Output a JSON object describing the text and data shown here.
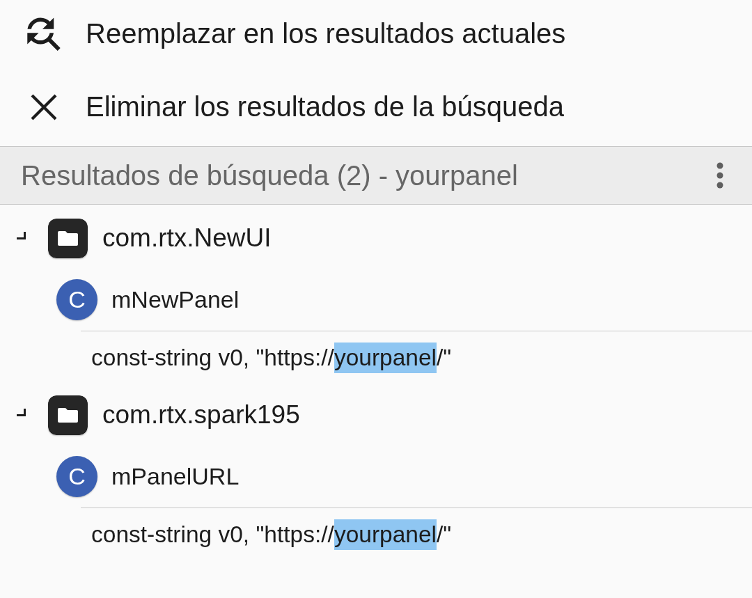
{
  "menu": [
    {
      "kind": "find_replace",
      "label": "Reemplazar en los resultados actuales"
    },
    {
      "kind": "close",
      "label": "Eliminar los resultados de la búsqueda"
    }
  ],
  "results_header": {
    "title": "Resultados de búsqueda (2) - yourpanel"
  },
  "results": [
    {
      "name": "com.rtx.NewUI",
      "expanded": true,
      "children": [
        {
          "kind": "class",
          "badge": "C",
          "name": "mNewPanel",
          "lines": [
            {
              "before": "const-string v0, \"https://",
              "match": "yourpanel",
              "after": "/\""
            }
          ]
        }
      ]
    },
    {
      "name": "com.rtx.spark195",
      "expanded": true,
      "children": [
        {
          "kind": "class",
          "badge": "C",
          "name": "mPanelURL",
          "lines": [
            {
              "before": "const-string v0, \"https://",
              "match": "yourpanel",
              "after": "/\""
            }
          ]
        }
      ]
    }
  ]
}
